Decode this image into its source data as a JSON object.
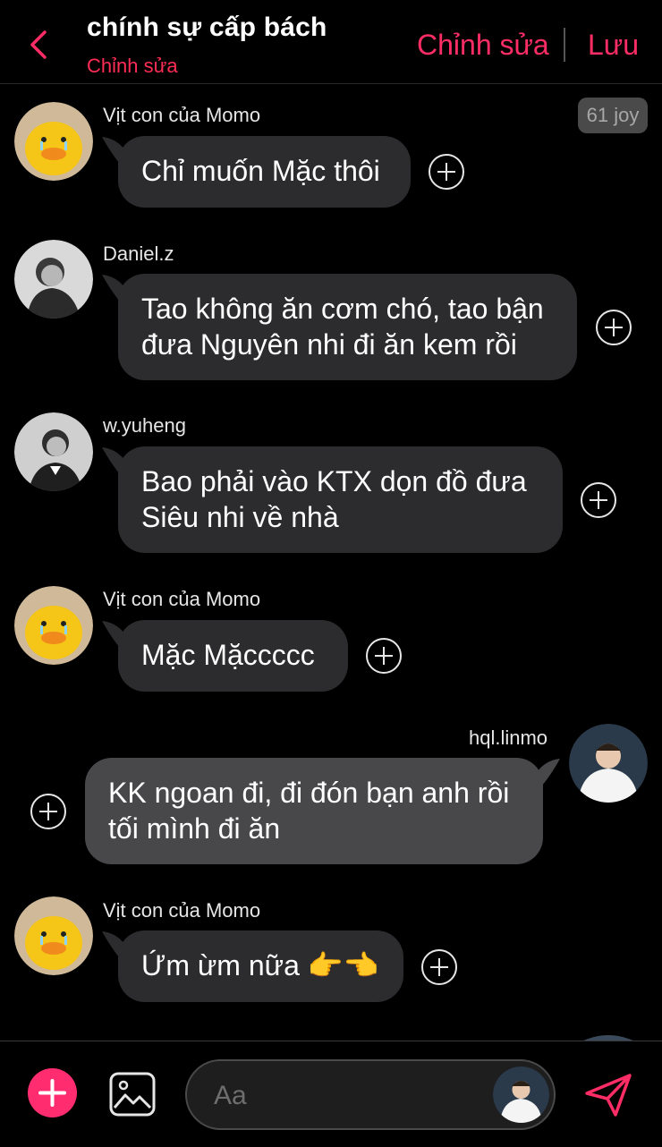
{
  "header": {
    "title": "chính sự cấp bách",
    "subtitle": "Chỉnh sửa",
    "edit_label": "Chỉnh sửa",
    "save_label": "Lưu"
  },
  "score_badge": "61 joy",
  "messages": [
    {
      "sender": "Vịt con của Momo",
      "text": "Chỉ muốn Mặc thôi",
      "avatar": "duck-avatar"
    },
    {
      "sender": "Daniel.z",
      "text": "Tao không ăn cơm chó, tao bận đưa Nguyên nhi đi ăn kem rồi",
      "avatar": "person-avatar"
    },
    {
      "sender": "w.yuheng",
      "text": "Bao phải vào KTX dọn đồ đưa Siêu nhi về nhà",
      "avatar": "person-avatar"
    },
    {
      "sender": "Vịt con của Momo",
      "text": "Mặc Mặccccc",
      "avatar": "duck-avatar"
    },
    {
      "sender": "hql.linmo",
      "text": "KK ngoan đi, đi đón bạn anh rồi tối mình đi ăn",
      "avatar": "person-avatar",
      "mine": true
    },
    {
      "sender": "Vịt con của Momo",
      "text": "Ứm ừm nữa 👉👈",
      "avatar": "duck-avatar"
    }
  ],
  "composer": {
    "placeholder": "Aa"
  },
  "colors": {
    "accent": "#ff2d66",
    "bubble": "#2c2c2e",
    "bubble_mine": "#48484a",
    "background": "#000000"
  },
  "icons": [
    "back-chevron-icon",
    "add-reaction-icon",
    "plus-icon",
    "image-icon",
    "send-icon"
  ]
}
